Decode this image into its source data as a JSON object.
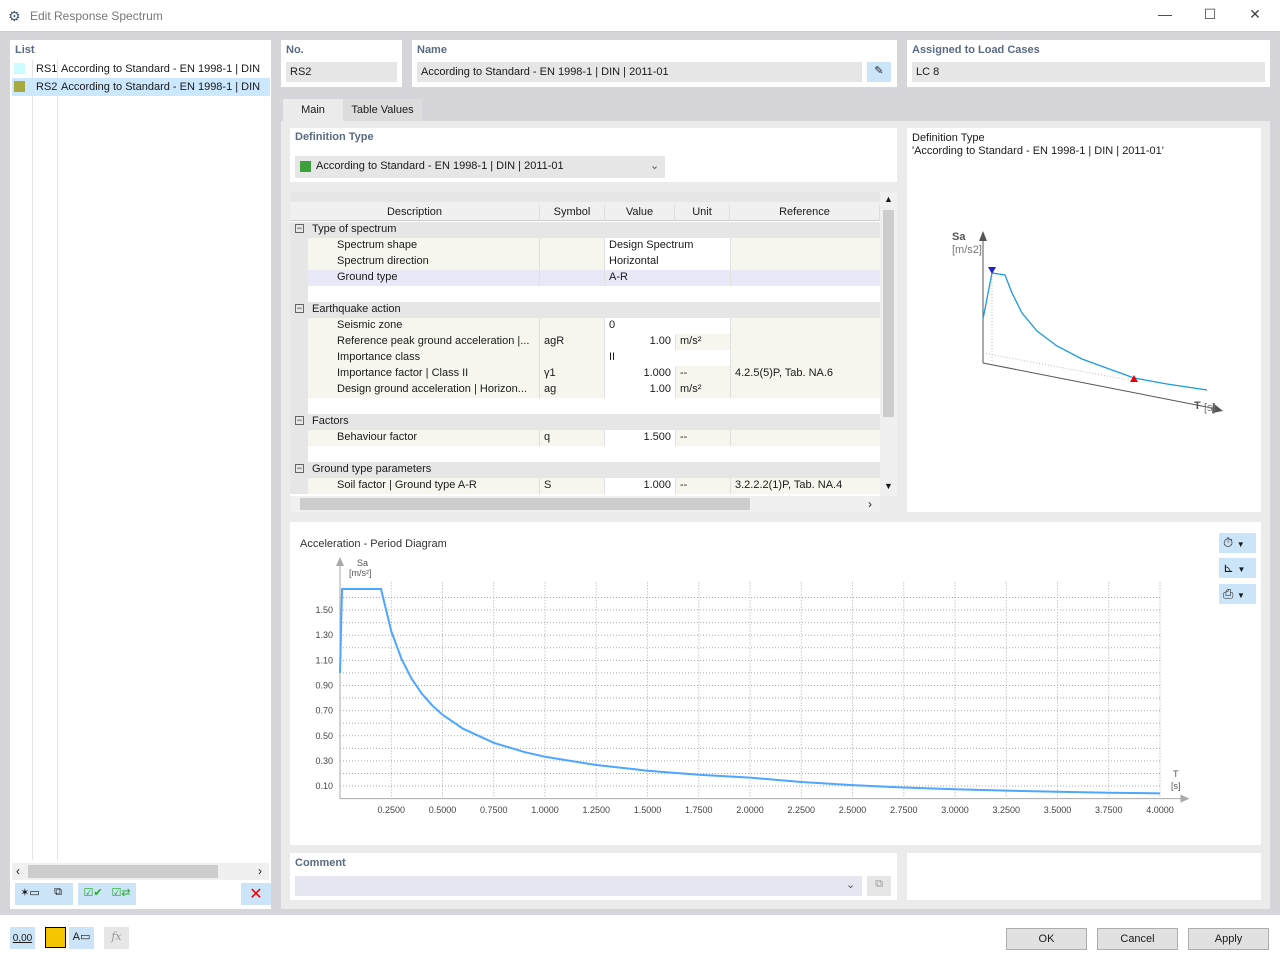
{
  "window": {
    "title": "Edit Response Spectrum",
    "minimize": "—",
    "maximize": "☐",
    "close": "✕"
  },
  "list": {
    "label": "List",
    "items": [
      {
        "id": "RS1",
        "name": "According to Standard - EN 1998-1 | DIN",
        "color": "#ccfcff"
      },
      {
        "id": "RS2",
        "name": "According to Standard - EN 1998-1 | DIN",
        "color": "#a8a840",
        "selected": true
      }
    ]
  },
  "no": {
    "label": "No.",
    "value": "RS2"
  },
  "name": {
    "label": "Name",
    "value": "According to Standard - EN 1998-1 | DIN | 2011-01"
  },
  "assigned": {
    "label": "Assigned to Load Cases",
    "value": "LC 8"
  },
  "tabs": [
    {
      "label": "Main",
      "active": true
    },
    {
      "label": "Table Values"
    }
  ],
  "definition": {
    "label": "Definition Type",
    "value": "According to Standard - EN 1998-1 | DIN | 2011-01",
    "color": "#3ca03c"
  },
  "table": {
    "columns": [
      "Description",
      "Symbol",
      "Value",
      "Unit",
      "Reference"
    ],
    "rows": [
      {
        "type": "group",
        "desc": "Type of spectrum"
      },
      {
        "desc": "Spectrum shape",
        "sym": "",
        "val": "Design Spectrum",
        "unit": "",
        "ref": "",
        "text": true
      },
      {
        "desc": "Spectrum direction",
        "sym": "",
        "val": "Horizontal",
        "unit": "",
        "ref": "",
        "text": true
      },
      {
        "desc": "Ground type",
        "sym": "",
        "val": "A-R",
        "unit": "",
        "ref": "",
        "text": true,
        "selected": true
      },
      {
        "type": "blank"
      },
      {
        "type": "group",
        "desc": "Earthquake action"
      },
      {
        "desc": "Seismic zone",
        "sym": "",
        "val": "0",
        "unit": "",
        "ref": "",
        "text": true
      },
      {
        "desc": "Reference peak ground acceleration |...",
        "sym": "agR",
        "val": "1.00",
        "unit": "m/s²",
        "ref": ""
      },
      {
        "desc": "Importance class",
        "sym": "",
        "val": "II",
        "unit": "",
        "ref": "",
        "text": true
      },
      {
        "desc": "Importance factor | Class II",
        "sym": "γ1",
        "val": "1.000",
        "unit": "--",
        "ref": "4.2.5(5)P, Tab. NA.6"
      },
      {
        "desc": "Design ground acceleration | Horizon...",
        "sym": "ag",
        "val": "1.00",
        "unit": "m/s²",
        "ref": ""
      },
      {
        "type": "blank"
      },
      {
        "type": "group",
        "desc": "Factors"
      },
      {
        "desc": "Behaviour factor",
        "sym": "q",
        "val": "1.500",
        "unit": "--",
        "ref": ""
      },
      {
        "type": "blank"
      },
      {
        "type": "group",
        "desc": "Ground type parameters"
      },
      {
        "desc": "Soil factor | Ground type A-R",
        "sym": "S",
        "val": "1.000",
        "unit": "--",
        "ref": "3.2.2.2(1)P, Tab. NA.4"
      }
    ]
  },
  "preview": {
    "line1": "Definition Type",
    "line2": "'According to Standard - EN 1998-1 | DIN | 2011-01'",
    "ylabel": "Sa",
    "yunit": "[m/s2]",
    "xlabel": "T",
    "xunit": "[s]"
  },
  "chart_data": {
    "type": "line",
    "title": "Acceleration - Period Diagram",
    "ylabel": "Sa",
    "yunit": "[m/s²]",
    "xlabel": "T",
    "xunit": "[s]",
    "xlim": [
      0,
      4
    ],
    "ylim": [
      0,
      1.7
    ],
    "grid": true,
    "color": "#4da6ff",
    "xticks": [
      "0.2500",
      "0.5000",
      "0.7500",
      "1.0000",
      "1.2500",
      "1.5000",
      "1.7500",
      "2.0000",
      "2.2500",
      "2.5000",
      "2.7500",
      "3.0000",
      "3.2500",
      "3.5000",
      "3.7500",
      "4.0000"
    ],
    "yticks": [
      "0.10",
      "0.30",
      "0.50",
      "0.70",
      "0.90",
      "1.10",
      "1.30",
      "1.50"
    ],
    "x": [
      0,
      0.01,
      0.2,
      0.25,
      0.3,
      0.35,
      0.4,
      0.45,
      0.5,
      0.6,
      0.75,
      0.9,
      1.0,
      1.25,
      1.5,
      1.75,
      2.0,
      2.25,
      2.5,
      2.75,
      3.0,
      3.25,
      3.5,
      3.75,
      4.0
    ],
    "y": [
      1.0,
      1.667,
      1.667,
      1.333,
      1.111,
      0.952,
      0.833,
      0.741,
      0.667,
      0.556,
      0.444,
      0.37,
      0.333,
      0.267,
      0.222,
      0.19,
      0.167,
      0.132,
      0.107,
      0.088,
      0.074,
      0.063,
      0.054,
      0.047,
      0.042
    ]
  },
  "comment": {
    "label": "Comment",
    "value": ""
  },
  "buttons": {
    "ok": "OK",
    "cancel": "Cancel",
    "apply": "Apply"
  },
  "footer": {
    "units_label": "0,00"
  }
}
